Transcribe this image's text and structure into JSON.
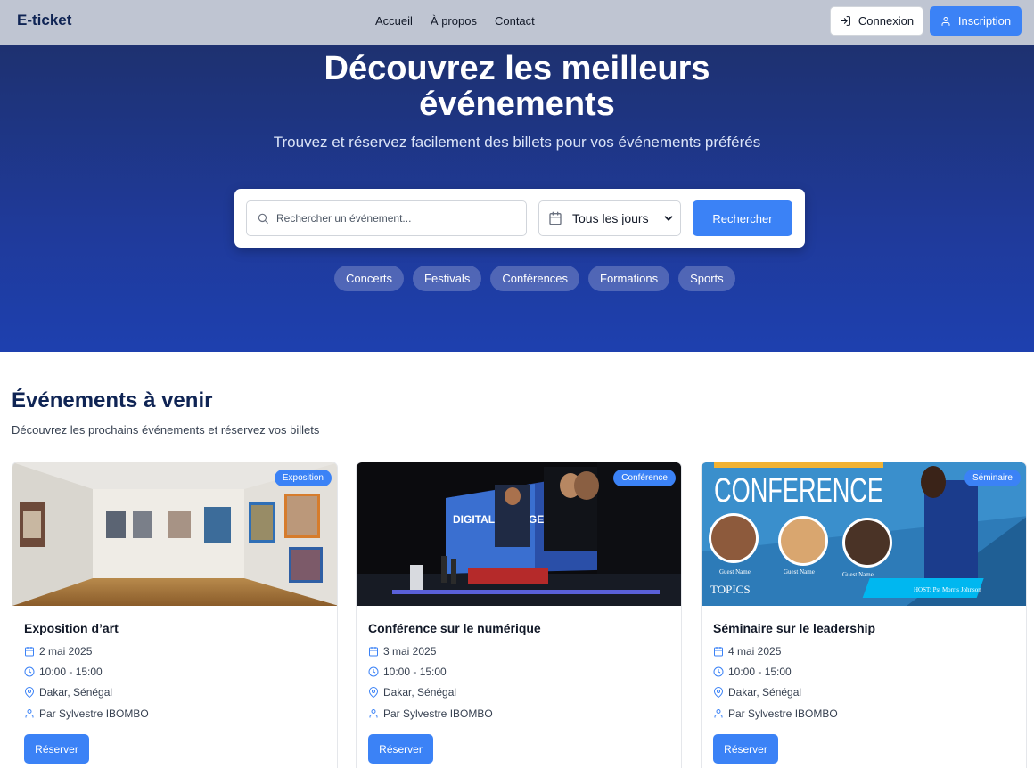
{
  "header": {
    "brand": "E-ticket",
    "nav": [
      "Accueil",
      "À propos",
      "Contact"
    ],
    "login_label": "Connexion",
    "signup_label": "Inscription"
  },
  "hero": {
    "title_line1": "Découvrez les meilleurs",
    "title_line2": "événements",
    "subtitle": "Trouvez et réservez facilement des billets pour vos événements préférés",
    "search": {
      "placeholder": "Rechercher un événement...",
      "value": "",
      "date_filter": "Tous les jours",
      "button_label": "Rechercher"
    },
    "categories": [
      "Concerts",
      "Festivals",
      "Conférences",
      "Formations",
      "Sports"
    ]
  },
  "events_section": {
    "title": "Événements à venir",
    "subtitle": "Découvrez les prochains événements et réservez vos billets",
    "cards": [
      {
        "badge": "Exposition",
        "title": "Exposition d’art",
        "date": "2 mai 2025",
        "time": "10:00 - 15:00",
        "location": "Dakar, Sénégal",
        "organizer": "Par Sylvestre IBOMBO",
        "button_label": "Réserver"
      },
      {
        "badge": "Conférence",
        "title": "Conférence sur le numérique",
        "date": "3 mai 2025",
        "time": "10:00 - 15:00",
        "location": "Dakar, Sénégal",
        "organizer": "Par Sylvestre IBOMBO",
        "button_label": "Réserver",
        "image_text": "DIGITAL CHANGE 2019"
      },
      {
        "badge": "Séminaire",
        "title": "Séminaire sur le leadership",
        "date": "4 mai 2025",
        "time": "10:00 - 15:00",
        "location": "Dakar, Sénégal",
        "organizer": "Par Sylvestre IBOMBO",
        "button_label": "Réserver",
        "image_text": {
          "headline": "CONFERENCE",
          "guest_label": "Guest Name",
          "topics": "TOPICS",
          "host": "HOST: Pst Morris Johnson"
        }
      }
    ]
  },
  "colors": {
    "accent": "#3b82f6",
    "hero_top": "#1e3170",
    "hero_bottom": "#1e40af",
    "navbar_bg": "#bfc5d2",
    "brand": "#0f2454"
  }
}
